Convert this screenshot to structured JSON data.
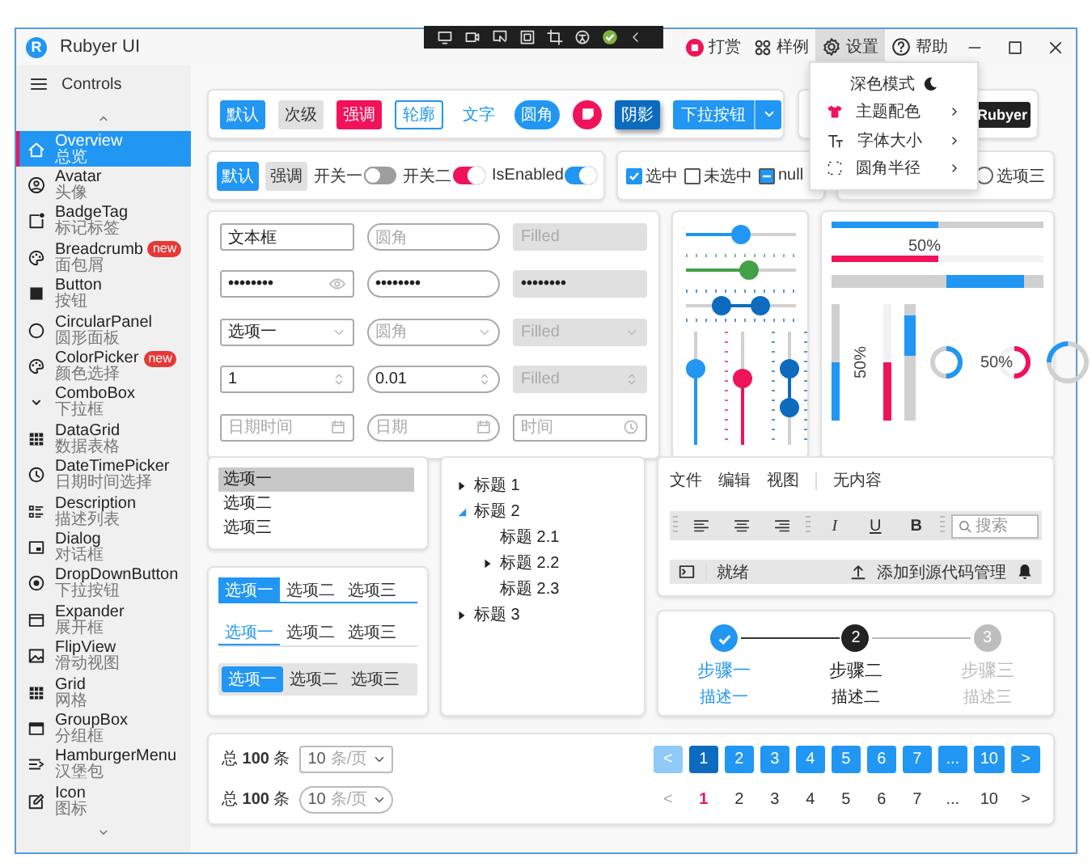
{
  "window": {
    "title": "Rubyer UI",
    "logo": "R"
  },
  "title_actions": [
    {
      "kind": "donate",
      "label": "打赏",
      "selected": false
    },
    {
      "kind": "samples",
      "label": "样例",
      "selected": false
    },
    {
      "kind": "settings",
      "label": "设置",
      "selected": true
    },
    {
      "kind": "help",
      "label": "帮助",
      "selected": false
    }
  ],
  "settings_menu": [
    {
      "kind": "toggle",
      "label": "深色模式"
    },
    {
      "kind": "submenu",
      "label": "主题配色"
    },
    {
      "kind": "submenu",
      "label": "字体大小"
    },
    {
      "kind": "submenu",
      "label": "圆角半径"
    }
  ],
  "sidebar": {
    "header": "Controls",
    "items": [
      {
        "name": "Overview",
        "subtitle": "总览",
        "selected": true
      },
      {
        "name": "Avatar",
        "subtitle": "头像",
        "selected": false
      },
      {
        "name": "BadgeTag",
        "subtitle": "标记标签",
        "selected": false
      },
      {
        "name": "Breadcrumb",
        "subtitle": "面包屑",
        "selected": false,
        "badge": "new"
      },
      {
        "name": "Button",
        "subtitle": "按钮",
        "selected": false
      },
      {
        "name": "CircularPanel",
        "subtitle": "圆形面板",
        "selected": false
      },
      {
        "name": "ColorPicker",
        "subtitle": "颜色选择",
        "selected": false,
        "badge": "new"
      },
      {
        "name": "ComboBox",
        "subtitle": "下拉框",
        "selected": false
      },
      {
        "name": "DataGrid",
        "subtitle": "数据表格",
        "selected": false
      },
      {
        "name": "DateTimePicker",
        "subtitle": "日期时间选择",
        "selected": false
      },
      {
        "name": "Description",
        "subtitle": "描述列表",
        "selected": false
      },
      {
        "name": "Dialog",
        "subtitle": "对话框",
        "selected": false
      },
      {
        "name": "DropDownButton",
        "subtitle": "下拉按钮",
        "selected": false
      },
      {
        "name": "Expander",
        "subtitle": "展开框",
        "selected": false
      },
      {
        "name": "FlipView",
        "subtitle": "滑动视图",
        "selected": false
      },
      {
        "name": "Grid",
        "subtitle": "网格",
        "selected": false
      },
      {
        "name": "GroupBox",
        "subtitle": "分组框",
        "selected": false
      },
      {
        "name": "HamburgerMenu",
        "subtitle": "汉堡包",
        "selected": false
      },
      {
        "name": "Icon",
        "subtitle": "图标",
        "selected": false
      }
    ]
  },
  "buttons": [
    {
      "kind": "primary",
      "label": "默认"
    },
    {
      "kind": "secondary",
      "label": "次级"
    },
    {
      "kind": "accent",
      "label": "强调"
    },
    {
      "kind": "outline",
      "label": "轮廓"
    },
    {
      "kind": "text",
      "label": "文字"
    },
    {
      "kind": "round",
      "label": "圆角"
    },
    {
      "kind": "icon"
    },
    {
      "kind": "shadow",
      "label": "阴影"
    },
    {
      "kind": "split",
      "label": "下拉按钮"
    }
  ],
  "tag": {
    "label": "Rubyer"
  },
  "row_buttons": [
    {
      "kind": "primary",
      "label": "默认"
    },
    {
      "kind": "secondary",
      "label": "强调"
    }
  ],
  "switches": [
    {
      "label": "开关一",
      "on": false
    },
    {
      "label": "开关二",
      "on": true,
      "color": "#f0135a"
    },
    {
      "label": "IsEnabled",
      "on": true,
      "color": "#2196f3"
    }
  ],
  "checkboxes": [
    {
      "label": "选中",
      "checked": true,
      "indeterminate": false
    },
    {
      "label": "未选中",
      "checked": false,
      "indeterminate": false
    },
    {
      "label": "null",
      "checked": false,
      "indeterminate": true
    }
  ],
  "radios": [
    {
      "label": "选项三",
      "selected": false
    }
  ],
  "fields": [
    {
      "kind": "text",
      "value": "文本框"
    },
    {
      "kind": "text",
      "placeholder": "圆角"
    },
    {
      "kind": "text",
      "placeholder": "Filled"
    },
    {
      "kind": "password-reveal",
      "value": "••••••••"
    },
    {
      "kind": "password",
      "value": "••••••••"
    },
    {
      "kind": "password",
      "value": "••••••••"
    },
    {
      "kind": "select",
      "value": "选项一"
    },
    {
      "kind": "select",
      "placeholder": "圆角"
    },
    {
      "kind": "select",
      "placeholder": "Filled"
    },
    {
      "kind": "number",
      "value": "1"
    },
    {
      "kind": "number",
      "value": "0.01"
    },
    {
      "kind": "number",
      "placeholder": "Filled"
    },
    {
      "kind": "datetime",
      "placeholder": "日期时间"
    },
    {
      "kind": "date",
      "placeholder": "日期"
    },
    {
      "kind": "time",
      "placeholder": "时间"
    }
  ],
  "sliders": [
    {
      "kind": "horizontal",
      "color": "#2196f3",
      "level": 0.5
    },
    {
      "kind": "horizontal",
      "color": "#43a047",
      "level": 0.57
    },
    {
      "kind": "horizontal-range",
      "color": "#0c6bbf",
      "thumbs": [
        {
          "level": 0.33
        },
        {
          "level": 0.67
        }
      ]
    },
    {
      "kind": "vertical",
      "color": "#2196f3",
      "level": 0.67
    },
    {
      "kind": "vertical",
      "color": "#f0135a",
      "level": 0.58
    },
    {
      "kind": "vertical-range",
      "color": "#0c6bbf",
      "thumbs": [
        {
          "level": 0.33
        },
        {
          "level": 0.67
        }
      ]
    }
  ],
  "progress": [
    {
      "kind": "bar",
      "color": "#2196f3",
      "level": 0.5
    },
    {
      "kind": "bar",
      "color": "#f0135a",
      "level": 0.5,
      "label": "50%"
    },
    {
      "kind": "bar-indeterminate",
      "color": "#2196f3"
    },
    {
      "kind": "vbar",
      "color": "#2196f3",
      "level": 0.5
    },
    {
      "kind": "vbar",
      "color": "#f0135a",
      "level": 0.5,
      "label": "50%"
    },
    {
      "kind": "vbar-indeterminate",
      "color": "#2196f3"
    },
    {
      "kind": "ring",
      "color": "#2196f3",
      "level": 0.5
    },
    {
      "kind": "ring",
      "color": "#f0135a",
      "level": 0.5,
      "label": "50%"
    },
    {
      "kind": "ring-indeterminate",
      "color": "#2196f3"
    }
  ],
  "list": [
    {
      "label": "选项一",
      "selected": true
    },
    {
      "label": "选项二",
      "selected": false
    },
    {
      "label": "选项三",
      "selected": false
    }
  ],
  "tab_groups": [
    {
      "kind": "filled",
      "tabs": [
        {
          "label": "选项一",
          "selected": true
        },
        {
          "label": "选项二",
          "selected": false
        },
        {
          "label": "选项三",
          "selected": false
        }
      ]
    },
    {
      "kind": "underline",
      "tabs": [
        {
          "label": "选项一",
          "selected": true
        },
        {
          "label": "选项二",
          "selected": false
        },
        {
          "label": "选项三",
          "selected": false
        }
      ]
    },
    {
      "kind": "segmented",
      "tabs": [
        {
          "label": "选项一",
          "selected": true
        },
        {
          "label": "选项二",
          "selected": false
        },
        {
          "label": "选项三",
          "selected": false
        }
      ]
    }
  ],
  "tree": [
    {
      "label": "标题 1",
      "kind": "branch",
      "expanded": false
    },
    {
      "label": "标题 2",
      "kind": "branch",
      "expanded": true,
      "children": [
        {
          "label": "标题 2.1",
          "kind": "leaf"
        },
        {
          "label": "标题 2.2",
          "kind": "branch",
          "expanded": false
        },
        {
          "label": "标题 2.3",
          "kind": "leaf"
        }
      ]
    },
    {
      "label": "标题 3",
      "kind": "branch",
      "expanded": false
    }
  ],
  "editor": {
    "menu": [
      "文件",
      "编辑",
      "视图"
    ],
    "extra_menu": [
      "无内容"
    ],
    "format_buttons": [
      {
        "kind": "italic",
        "label": "I"
      },
      {
        "kind": "underline",
        "label": "U"
      },
      {
        "kind": "bold",
        "label": "B"
      }
    ],
    "search": {
      "placeholder": "搜索"
    },
    "status": "就绪",
    "action": "添加到源代码管理"
  },
  "steps": [
    {
      "completed": true,
      "selected": false,
      "title": "步骤一",
      "description": "描述一"
    },
    {
      "completed": false,
      "selected": true,
      "number": "2",
      "title": "步骤二",
      "description": "描述二"
    },
    {
      "completed": false,
      "selected": false,
      "number": "3",
      "title": "步骤三",
      "description": "描述三"
    }
  ],
  "pagination": [
    {
      "kind": "filled",
      "total": "总 **100** 条",
      "page_size": "10",
      "page_size_unit": "条/页",
      "prev": {
        "label": "<",
        "disabled": true
      },
      "pages": [
        {
          "label": "1",
          "selected": true
        },
        {
          "label": "2",
          "selected": false
        },
        {
          "label": "3",
          "selected": false
        },
        {
          "label": "4",
          "selected": false
        },
        {
          "label": "5",
          "selected": false
        },
        {
          "label": "6",
          "selected": false
        },
        {
          "label": "7",
          "selected": false
        },
        {
          "label": "...",
          "selected": false
        },
        {
          "label": "10",
          "selected": false
        }
      ],
      "next": {
        "label": ">",
        "disabled": false
      }
    },
    {
      "kind": "plain",
      "total": "总 **100** 条",
      "page_size": "10",
      "page_size_unit": "条/页",
      "prev": {
        "label": "<",
        "disabled": true
      },
      "pages": [
        {
          "label": "1",
          "selected": true
        },
        {
          "label": "2",
          "selected": false
        },
        {
          "label": "3",
          "selected": false
        },
        {
          "label": "4",
          "selected": false
        },
        {
          "label": "5",
          "selected": false
        },
        {
          "label": "6",
          "selected": false
        },
        {
          "label": "7",
          "selected": false
        },
        {
          "label": "...",
          "selected": false
        },
        {
          "label": "10",
          "selected": false
        }
      ],
      "next": {
        "label": ">",
        "disabled": false
      }
    }
  ]
}
